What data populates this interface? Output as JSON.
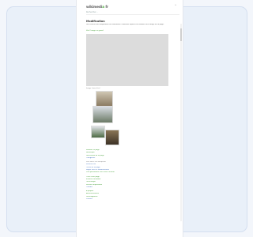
{
  "header": {
    "logo_main": "wikimedi",
    "logo_accent": "a",
    "logo_suffix": " fr",
    "menu_link": "≡",
    "search_text": "Rechercher…"
  },
  "article": {
    "title": "Modification",
    "body": "Des fichiers sont disponibles sur Wikimedia Commons. Ajouter ou modifier une image sur la page.",
    "caption_link": "Voir l’image en grand",
    "viewer_caption": "Image (sans titre)"
  },
  "links": [
    {
      "text": "Modifier la page",
      "kind": "green"
    },
    {
      "text": "Historique",
      "kind": "green"
    },
    {
      "text": "Discussion de la page",
      "kind": "green"
    },
    {
      "text": "Catégories",
      "kind": "blue"
    },
    {
      "text": "Voir aussi sur Wikipédia",
      "kind": "grey"
    },
    {
      "text": "Fichiers liés",
      "kind": "blue"
    },
    {
      "text": "Outils de la page",
      "kind": "blue"
    },
    {
      "text": "Pages liées et modifications",
      "kind": "blue"
    },
    {
      "text": "Lien permanent vers cette version",
      "kind": "green"
    },
    {
      "text": "Citer cette page",
      "kind": "green"
    },
    {
      "text": "Élément Wikidata",
      "kind": "green"
    },
    {
      "text": "Télécharger",
      "kind": "green"
    },
    {
      "text": "Version imprimable",
      "kind": "green"
    },
    {
      "text": "Contact",
      "kind": "blue"
    },
    {
      "text": "À propos",
      "kind": "green"
    },
    {
      "text": "Avertissements",
      "kind": "green"
    },
    {
      "text": "Développeurs",
      "kind": "green"
    },
    {
      "text": "Licence",
      "kind": "blue"
    }
  ]
}
